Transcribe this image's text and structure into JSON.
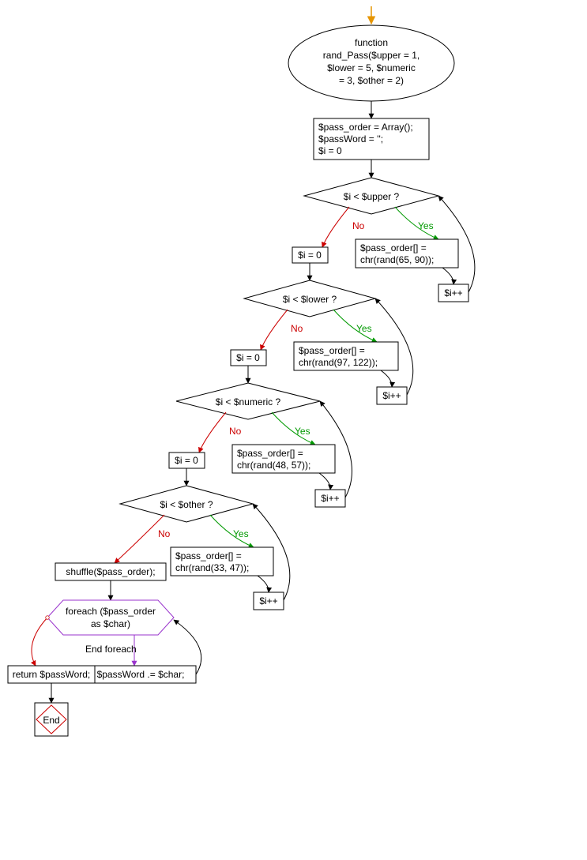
{
  "chart_data": {
    "type": "diagram",
    "title": "",
    "nodes": [
      {
        "id": "start",
        "shape": "ellipse",
        "lines": [
          "function",
          "rand_Pass($upper = 1,",
          "$lower = 5, $numeric",
          "= 3, $other = 2)"
        ]
      },
      {
        "id": "init",
        "shape": "rect",
        "lines": [
          "$pass_order = Array();",
          "$passWord = '';",
          "$i = 0"
        ]
      },
      {
        "id": "d_upper",
        "shape": "diamond",
        "lines": [
          "$i < $upper ?"
        ]
      },
      {
        "id": "b_upper",
        "shape": "rect",
        "lines": [
          "$pass_order[] =",
          "chr(rand(65, 90));"
        ]
      },
      {
        "id": "inc1",
        "shape": "rect",
        "lines": [
          "$i++"
        ]
      },
      {
        "id": "reset1",
        "shape": "rect",
        "lines": [
          "$i = 0"
        ]
      },
      {
        "id": "d_lower",
        "shape": "diamond",
        "lines": [
          "$i < $lower ?"
        ]
      },
      {
        "id": "b_lower",
        "shape": "rect",
        "lines": [
          "$pass_order[] =",
          "chr(rand(97, 122));"
        ]
      },
      {
        "id": "inc2",
        "shape": "rect",
        "lines": [
          "$i++"
        ]
      },
      {
        "id": "reset2",
        "shape": "rect",
        "lines": [
          "$i = 0"
        ]
      },
      {
        "id": "d_numeric",
        "shape": "diamond",
        "lines": [
          "$i < $numeric ?"
        ]
      },
      {
        "id": "b_numeric",
        "shape": "rect",
        "lines": [
          "$pass_order[] =",
          "chr(rand(48, 57));"
        ]
      },
      {
        "id": "inc3",
        "shape": "rect",
        "lines": [
          "$i++"
        ]
      },
      {
        "id": "reset3",
        "shape": "rect",
        "lines": [
          "$i = 0"
        ]
      },
      {
        "id": "d_other",
        "shape": "diamond",
        "lines": [
          "$i < $other ?"
        ]
      },
      {
        "id": "b_other",
        "shape": "rect",
        "lines": [
          "$pass_order[] =",
          "chr(rand(33, 47));"
        ]
      },
      {
        "id": "inc4",
        "shape": "rect",
        "lines": [
          "$i++"
        ]
      },
      {
        "id": "shuffle",
        "shape": "rect",
        "lines": [
          "shuffle($pass_order);"
        ]
      },
      {
        "id": "foreach",
        "shape": "hexagon",
        "lines": [
          "foreach ($pass_order",
          "as $char)"
        ]
      },
      {
        "id": "concat",
        "shape": "rect",
        "lines": [
          "$passWord .= $char;"
        ]
      },
      {
        "id": "return",
        "shape": "rect",
        "lines": [
          "return $passWord;"
        ]
      },
      {
        "id": "end",
        "shape": "end",
        "lines": [
          "End"
        ]
      }
    ],
    "edges": [
      {
        "from": "entry",
        "to": "start",
        "label": "",
        "style": "orange"
      },
      {
        "from": "start",
        "to": "init",
        "label": "",
        "style": "black"
      },
      {
        "from": "init",
        "to": "d_upper",
        "label": "",
        "style": "black"
      },
      {
        "from": "d_upper",
        "to": "b_upper",
        "label": "Yes",
        "style": "green"
      },
      {
        "from": "b_upper",
        "to": "inc1",
        "label": "",
        "style": "black"
      },
      {
        "from": "inc1",
        "to": "d_upper",
        "label": "",
        "style": "black"
      },
      {
        "from": "d_upper",
        "to": "reset1",
        "label": "No",
        "style": "red"
      },
      {
        "from": "reset1",
        "to": "d_lower",
        "label": "",
        "style": "black"
      },
      {
        "from": "d_lower",
        "to": "b_lower",
        "label": "Yes",
        "style": "green"
      },
      {
        "from": "b_lower",
        "to": "inc2",
        "label": "",
        "style": "black"
      },
      {
        "from": "inc2",
        "to": "d_lower",
        "label": "",
        "style": "black"
      },
      {
        "from": "d_lower",
        "to": "reset2",
        "label": "No",
        "style": "red"
      },
      {
        "from": "reset2",
        "to": "d_numeric",
        "label": "",
        "style": "black"
      },
      {
        "from": "d_numeric",
        "to": "b_numeric",
        "label": "Yes",
        "style": "green"
      },
      {
        "from": "b_numeric",
        "to": "inc3",
        "label": "",
        "style": "black"
      },
      {
        "from": "inc3",
        "to": "d_numeric",
        "label": "",
        "style": "black"
      },
      {
        "from": "d_numeric",
        "to": "reset3",
        "label": "No",
        "style": "red"
      },
      {
        "from": "reset3",
        "to": "d_other",
        "label": "",
        "style": "black"
      },
      {
        "from": "d_other",
        "to": "b_other",
        "label": "Yes",
        "style": "green"
      },
      {
        "from": "b_other",
        "to": "inc4",
        "label": "",
        "style": "black"
      },
      {
        "from": "inc4",
        "to": "d_other",
        "label": "",
        "style": "black"
      },
      {
        "from": "d_other",
        "to": "shuffle",
        "label": "No",
        "style": "red"
      },
      {
        "from": "shuffle",
        "to": "foreach",
        "label": "",
        "style": "black"
      },
      {
        "from": "foreach",
        "to": "concat",
        "label": "",
        "style": "purple"
      },
      {
        "from": "concat",
        "to": "foreach",
        "label": "",
        "style": "black"
      },
      {
        "from": "foreach",
        "to": "return",
        "label": "End foreach",
        "style": "red"
      },
      {
        "from": "return",
        "to": "end",
        "label": "",
        "style": "black"
      }
    ],
    "labels": {
      "yes": "Yes",
      "no": "No",
      "end_foreach": "End foreach"
    }
  }
}
